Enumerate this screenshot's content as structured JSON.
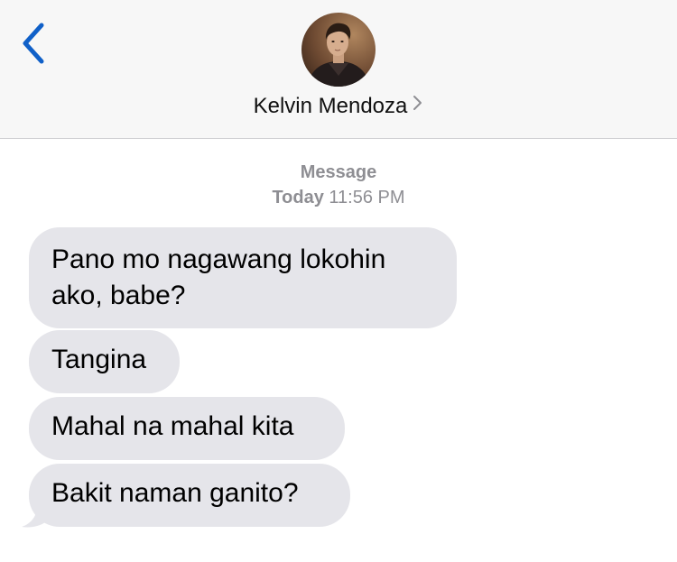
{
  "header": {
    "back_icon": "chevron-left-icon",
    "contact_name": "Kelvin Mendoza",
    "contact_chevron_icon": "chevron-right-icon",
    "accent_color": "#1060c8"
  },
  "meta": {
    "service": "Message",
    "day": "Today",
    "time": "11:56 PM"
  },
  "messages": [
    {
      "line1": "Pano mo nagawang lokohin",
      "line2": "ako, babe?"
    },
    {
      "text": "Tangina"
    },
    {
      "text": "Mahal na mahal kita"
    },
    {
      "text": "Bakit naman ganito?"
    }
  ],
  "colors": {
    "incoming_bubble": "#e5e5ea",
    "meta_text": "#8e8e93",
    "header_bg": "#f7f7f7"
  }
}
